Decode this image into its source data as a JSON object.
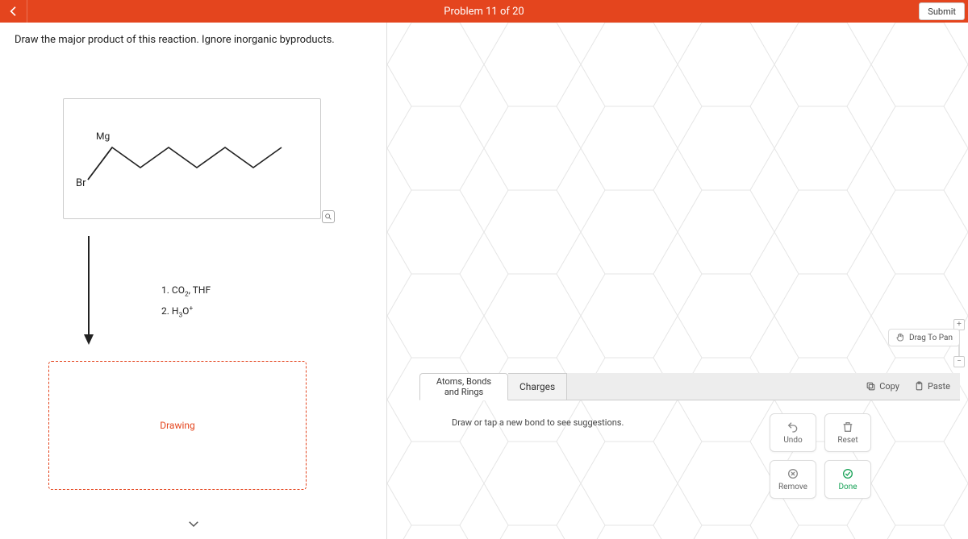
{
  "header": {
    "title": "Problem 11 of 20",
    "submit_label": "Submit"
  },
  "prompt": "Draw the major product of this reaction.  Ignore inorganic byproducts.",
  "reactant": {
    "labels": {
      "br": "Br",
      "mg": "Mg"
    }
  },
  "reagents": {
    "line1": "1. CO₂, THF",
    "line2": "2. H₃O⁺"
  },
  "drawing_label": "Drawing",
  "canvas": {
    "drag_label": "Drag To Pan",
    "zoom_plus": "+",
    "zoom_minus": "−"
  },
  "tabs": {
    "atoms": "Atoms, Bonds\nand Rings",
    "charges": "Charges"
  },
  "toolbar": {
    "copy": "Copy",
    "paste": "Paste"
  },
  "suggestion": "Draw or tap a new bond to see suggestions.",
  "actions": {
    "undo": "Undo",
    "reset": "Reset",
    "remove": "Remove",
    "done": "Done"
  }
}
